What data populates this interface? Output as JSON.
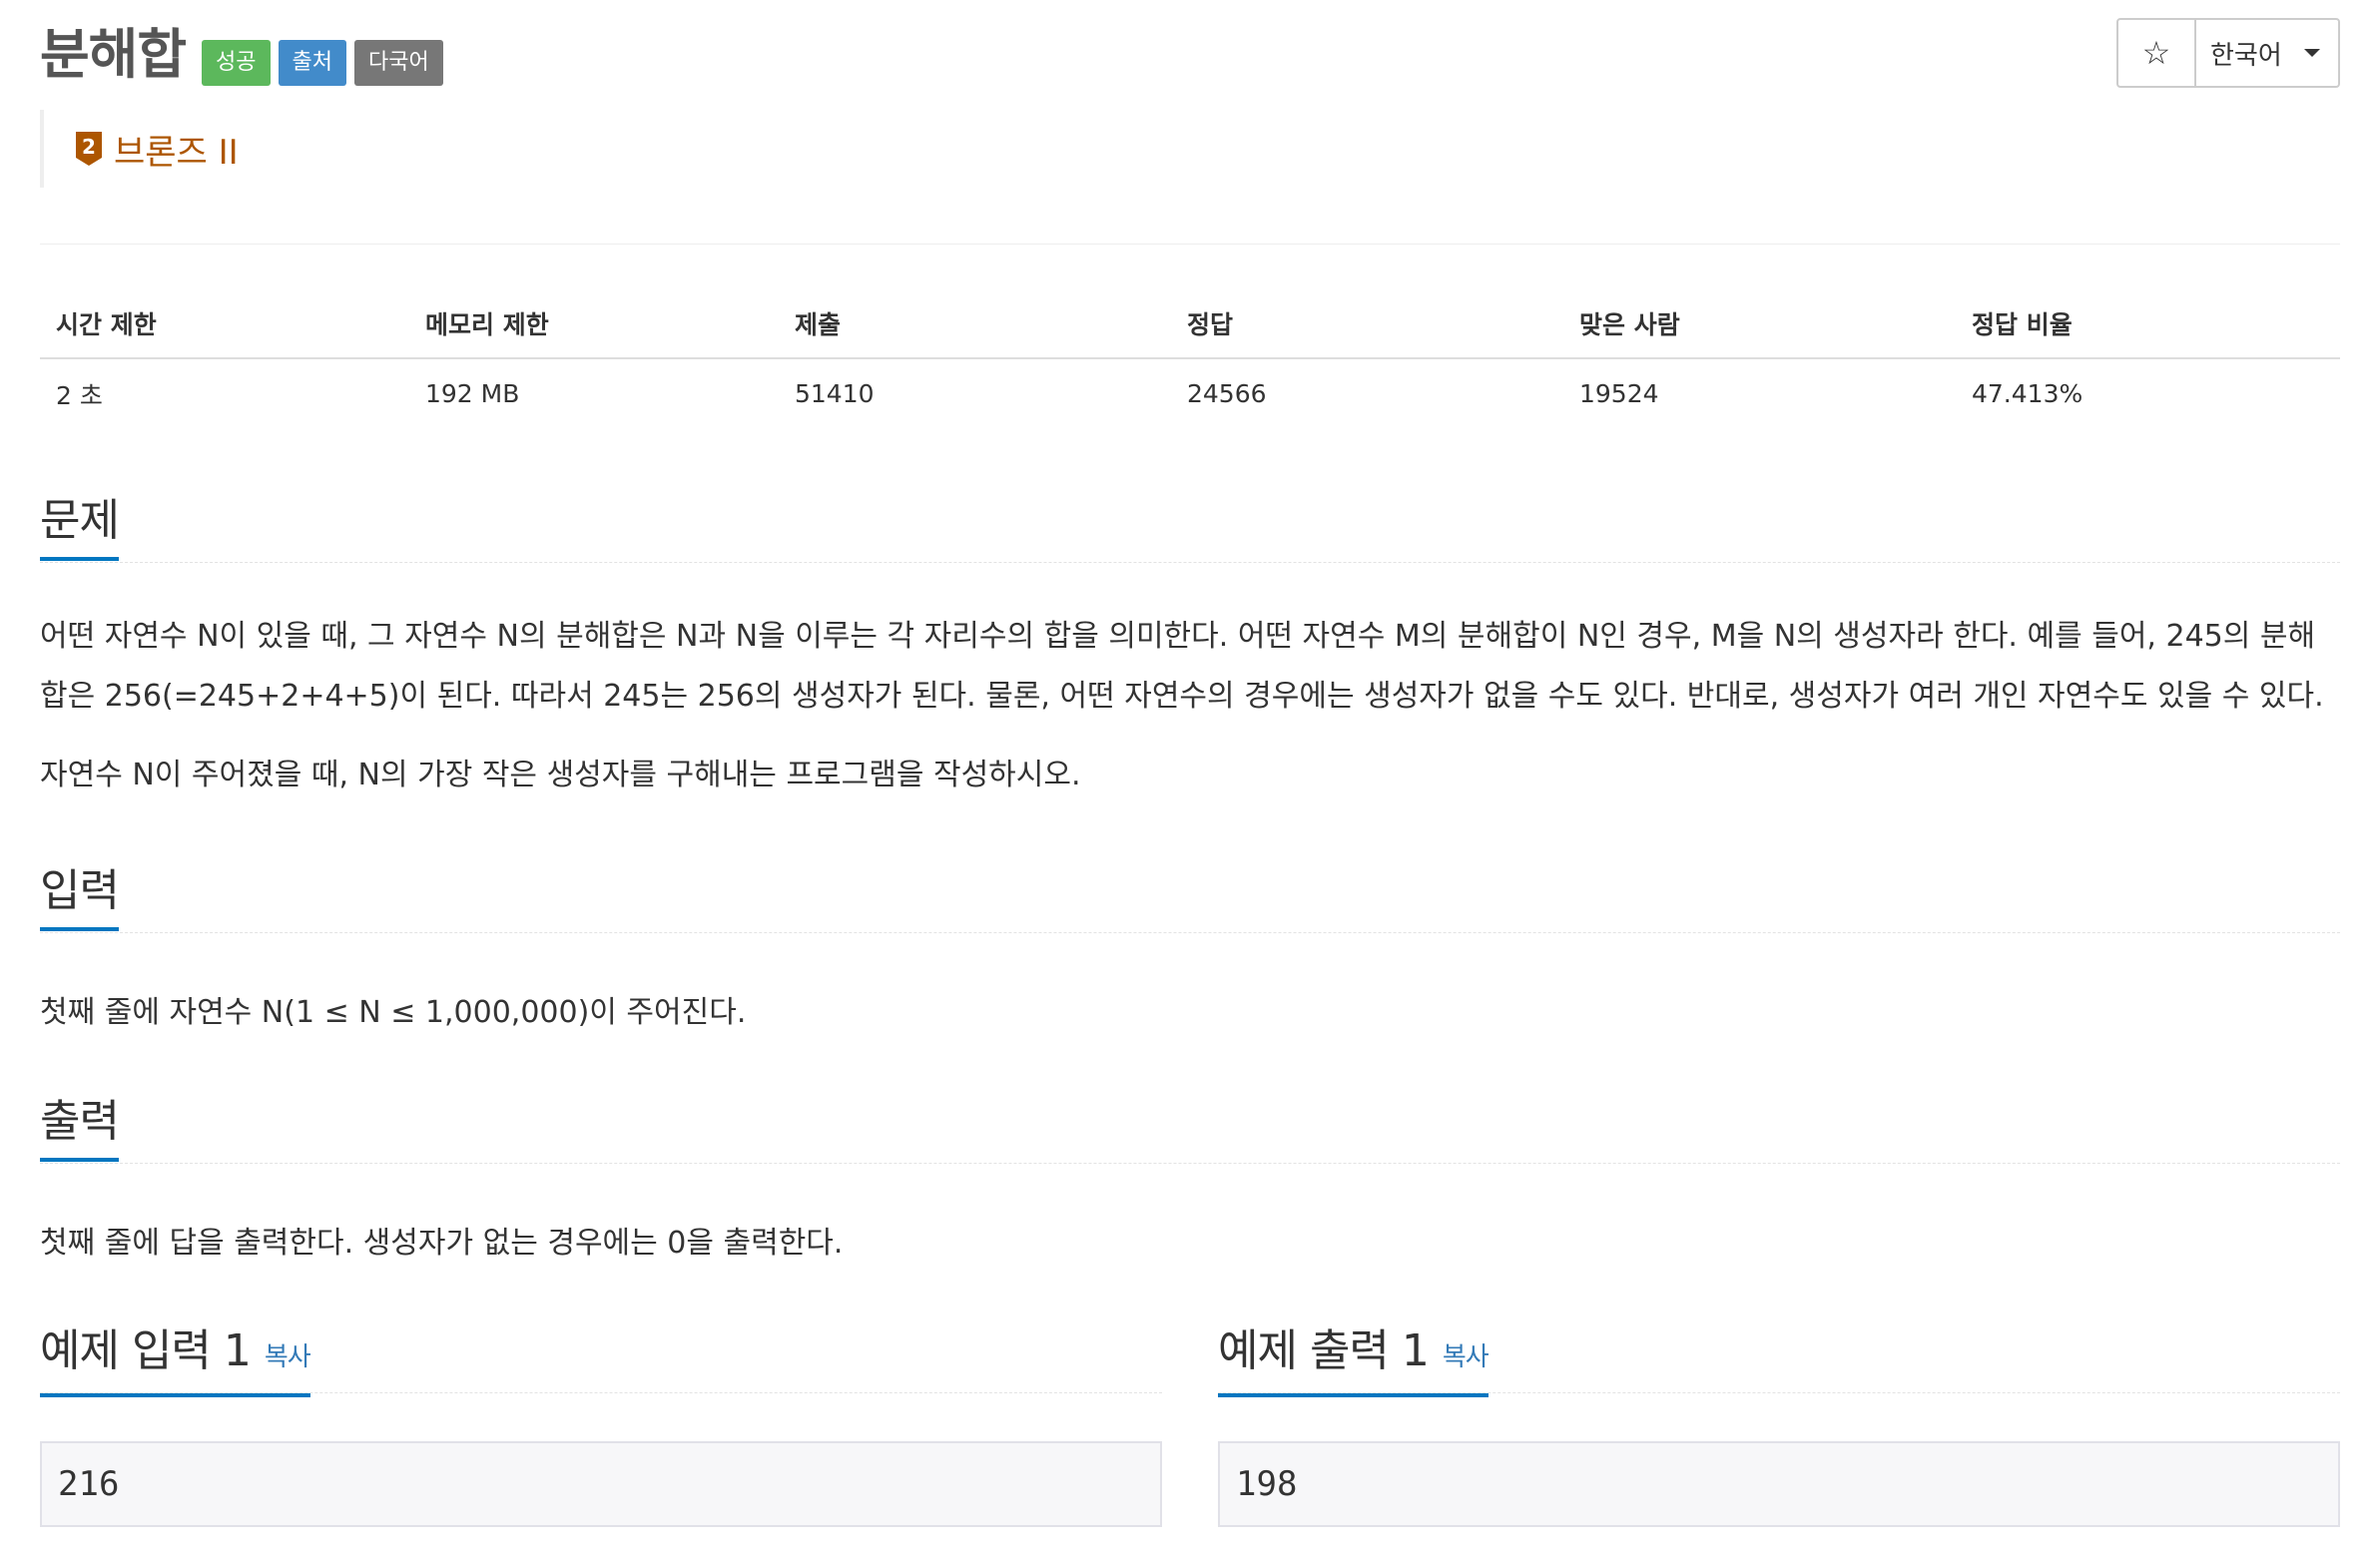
{
  "problem": {
    "title": "분해합",
    "labels": [
      "성공",
      "출처",
      "다국어"
    ],
    "tier": "브론즈 II",
    "tier_level": "2"
  },
  "toolbar": {
    "star_icon": "☆",
    "language": "한국어"
  },
  "info_table": {
    "headers": [
      "시간 제한",
      "메모리 제한",
      "제출",
      "정답",
      "맞은 사람",
      "정답 비율"
    ],
    "values": [
      "2 초",
      "192 MB",
      "51410",
      "24566",
      "19524",
      "47.413%"
    ]
  },
  "sections": {
    "description": {
      "heading": "문제",
      "paragraphs": [
        "어떤 자연수 N이 있을 때, 그 자연수 N의 분해합은 N과 N을 이루는 각 자리수의 합을 의미한다. 어떤 자연수 M의 분해합이 N인 경우, M을 N의 생성자라 한다. 예를 들어, 245의 분해합은 256(=245+2+4+5)이 된다. 따라서 245는 256의 생성자가 된다. 물론, 어떤 자연수의 경우에는 생성자가 없을 수도 있다. 반대로, 생성자가 여러 개인 자연수도 있을 수 있다.",
        "자연수 N이 주어졌을 때, N의 가장 작은 생성자를 구해내는 프로그램을 작성하시오."
      ]
    },
    "input": {
      "heading": "입력",
      "text": "첫째 줄에 자연수 N(1 ≤ N ≤ 1,000,000)이 주어진다."
    },
    "output": {
      "heading": "출력",
      "text": "첫째 줄에 답을 출력한다. 생성자가 없는 경우에는 0을 출력한다."
    }
  },
  "samples": {
    "input": {
      "heading": "예제 입력 1",
      "copy_label": "복사",
      "value": "216"
    },
    "output": {
      "heading": "예제 출력 1",
      "copy_label": "복사",
      "value": "198"
    }
  },
  "colors": {
    "accent": "#0076c0",
    "tier": "#ad5600",
    "label_success": "#5cb85c",
    "label_source": "#428bca",
    "label_multilang": "#777777"
  }
}
